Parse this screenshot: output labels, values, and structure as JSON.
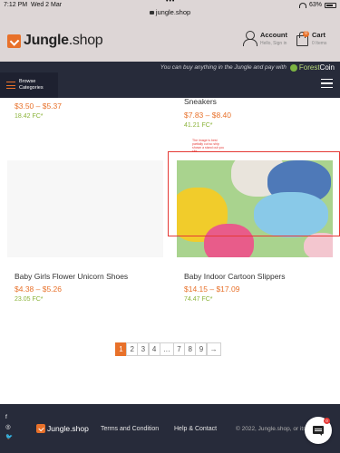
{
  "status": {
    "time": "7:12 PM",
    "date": "Wed 2 Mar",
    "url": "jungle.shop",
    "battery": "63%"
  },
  "header": {
    "logo_main": "Jungle",
    "logo_suffix": ".shop",
    "account_label": "Account",
    "account_sub": "Hello, Sign in",
    "cart_label": "Cart",
    "cart_sub": "0 Items",
    "cart_count": "0"
  },
  "nav": {
    "promo": "You can buy anything in the Jungle and pay with",
    "coin_a": "Forest",
    "coin_b": "Coin",
    "browse_line1": "Browse",
    "browse_line2": "Categories"
  },
  "products": [
    {
      "title": "",
      "price": "$3.50 – $5.37",
      "fc": "18.42 FC*"
    },
    {
      "title": "Sneakers",
      "price": "$7.83 – $8.40",
      "fc": "41.21 FC*"
    },
    {
      "title": "Baby Girls Flower Unicorn Shoes",
      "price": "$4.38 – $5.26",
      "fc": "23.05 FC*"
    },
    {
      "title": "Baby Indoor Cartoon Slippers",
      "price": "$14.15 – $17.09",
      "fc": "74.47 FC*"
    }
  ],
  "image_note": "The image is best partially cut so ship shown a stand out you site",
  "pagination": {
    "pages": [
      "1",
      "2",
      "3",
      "4",
      "…",
      "7",
      "8",
      "9",
      "→"
    ],
    "active": "1"
  },
  "footer": {
    "social": [
      "f",
      "◎",
      "🐦"
    ],
    "logo_main": "Jungle",
    "logo_suffix": ".shop",
    "links": [
      "Terms and Condition",
      "Help & Contact"
    ],
    "copyright": "© 2022, Jungle.shop, or its aff...",
    "chat_badge": "0"
  }
}
